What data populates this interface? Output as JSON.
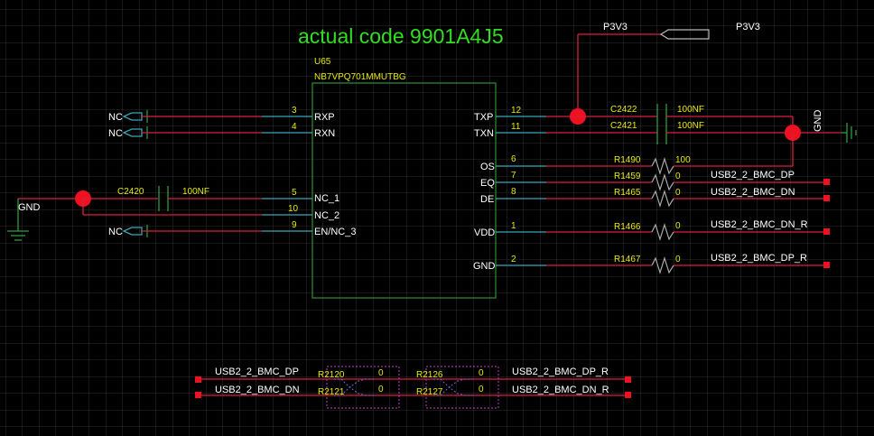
{
  "title": "actual code 9901A4J5",
  "chip": {
    "refdes": "U65",
    "part": "NB7VPQ701MMUTBG",
    "left_pins": [
      {
        "num": "3",
        "name": "RXP"
      },
      {
        "num": "4",
        "name": "RXN"
      },
      {
        "num": "5",
        "name": "NC_1"
      },
      {
        "num": "10",
        "name": "NC_2"
      },
      {
        "num": "9",
        "name": "EN/NC_3"
      }
    ],
    "right_pins": [
      {
        "num": "12",
        "name": "TXP"
      },
      {
        "num": "11",
        "name": "TXN"
      },
      {
        "num": "6",
        "name": "OS"
      },
      {
        "num": "7",
        "name": "EQ"
      },
      {
        "num": "8",
        "name": "DE"
      },
      {
        "num": "1",
        "name": "VDD"
      },
      {
        "num": "2",
        "name": "GND"
      }
    ]
  },
  "nc_labels": [
    "NC",
    "NC",
    "NC"
  ],
  "power": {
    "p3v3_net": "P3V3",
    "p3v3_port": "P3V3",
    "gnd_left": "GND",
    "gnd_right": "GND"
  },
  "capacitors": [
    {
      "ref": "C2422",
      "value": "100NF"
    },
    {
      "ref": "C2421",
      "value": "100NF"
    },
    {
      "ref": "C2420",
      "value": "100NF"
    }
  ],
  "resistors": [
    {
      "ref": "R1490",
      "value": "100",
      "net": ""
    },
    {
      "ref": "R1459",
      "value": "0",
      "net": "USB2_2_BMC_DP"
    },
    {
      "ref": "R1465",
      "value": "0",
      "net": "USB2_2_BMC_DN"
    },
    {
      "ref": "R1466",
      "value": "0",
      "net": "USB2_2_BMC_DN_R"
    },
    {
      "ref": "R1467",
      "value": "0",
      "net": "USB2_2_BMC_DP_R"
    }
  ],
  "bottom": {
    "net_left_top": "USB2_2_BMC_DP",
    "net_left_bottom": "USB2_2_BMC_DN",
    "net_right_top": "USB2_2_BMC_DP_R",
    "net_right_bottom": "USB2_2_BMC_DN_R",
    "r_a_top": "R2120",
    "r_a_bottom": "R2121",
    "r_b_top": "R2126",
    "r_b_bottom": "R2127",
    "val_a_top": "0",
    "val_a_bottom": "0",
    "val_b_top": "0",
    "val_b_bottom": "0"
  }
}
